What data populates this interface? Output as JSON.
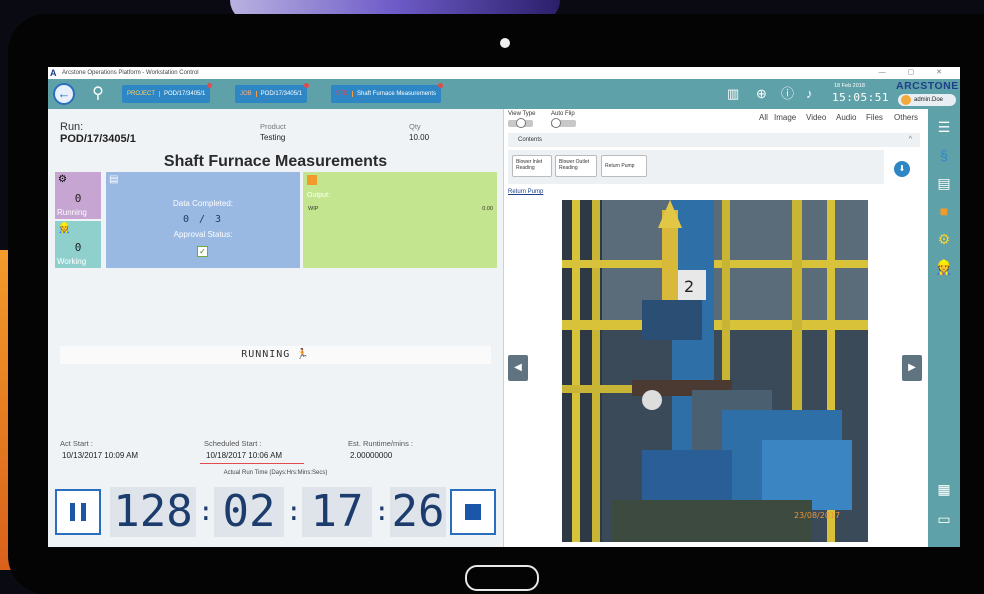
{
  "window": {
    "title": "Arcstone Operations Platform - Workstation Control",
    "controls": "— ▢ ✕"
  },
  "topbar": {
    "back_icon": "back-arrow-icon",
    "search_icon": "search-icon",
    "crumbs": [
      {
        "tag": "PROJECT",
        "value": "POD/17/3405/1"
      },
      {
        "tag": "JOB",
        "value": "POD/17/3405/1"
      },
      {
        "tag": "STD",
        "value": "Shaft Furnace Measurements"
      }
    ],
    "date": "18 Feb 2018",
    "time": "15:05:51",
    "brand": "ARCSTONE",
    "user": "admin.Doe"
  },
  "left": {
    "run_label": "Run:",
    "run_value": "POD/17/3405/1",
    "product_label": "Product",
    "product_value": "Testing",
    "qty_label": "Qty",
    "qty_value": "10.00",
    "title": "Shaft Furnace Measurements",
    "running_tile": {
      "count": "0",
      "label": "Running"
    },
    "working_tile": {
      "count": "0",
      "label": "Working"
    },
    "data_completed_label": "Data Completed:",
    "data_completed_value": "0 / 3",
    "approval_label": "Approval Status:",
    "output_label": "Output:",
    "output_item": "WIP",
    "output_value": "0.00",
    "status": "RUNNING",
    "act_start_label": "Act Start :",
    "act_start_value": "10/13/2017 10:09 AM",
    "sched_start_label": "Scheduled Start :",
    "sched_start_value": "10/18/2017 10:06 AM",
    "est_runtime_label": "Est. Runtime/mins :",
    "est_runtime_value": "2.00000000",
    "actual_runtime_label": "Actual Run Time (Days:Hrs:Mins:Secs)",
    "timer": {
      "days": "128",
      "hours": "02",
      "mins": "17",
      "secs": "26"
    }
  },
  "right": {
    "view_type_label": "View Type",
    "auto_flip_label": "Auto Flip",
    "filters": [
      "All",
      "Image",
      "Video",
      "Audio",
      "Files",
      "Others"
    ],
    "contents_label": "Contents",
    "content_buttons": [
      "Blower Inlet Reading",
      "Blower Outlet Reading",
      "Return Pump"
    ],
    "current_item": "Return Pump",
    "photo_stamp": "23/08/2017"
  },
  "colors": {
    "teal": "#5fa1a8",
    "blue": "#2f86c5",
    "purple": "#c7a5d2",
    "green": "#c4e58f",
    "lightblue": "#99b8e2"
  }
}
